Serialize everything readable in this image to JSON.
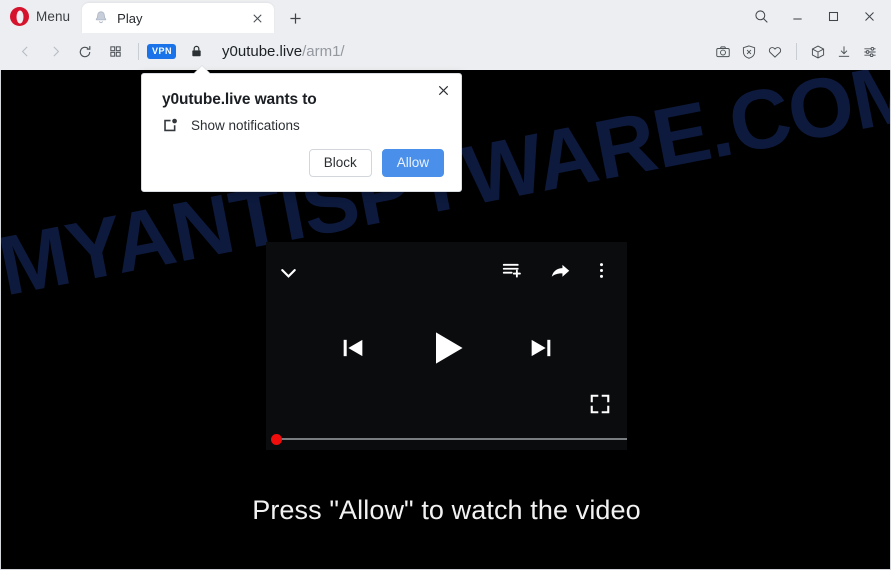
{
  "browser": {
    "name": "Opera",
    "menu_label": "Menu",
    "tab": {
      "title": "Play",
      "favicon": "bell-icon",
      "close_icon": "close-icon"
    },
    "new_tab_icon": "plus-icon",
    "window_controls": [
      {
        "name": "search",
        "icon": "search-icon",
        "glyph": "search"
      },
      {
        "name": "minimize",
        "icon": "minimize-icon",
        "glyph": "minimize"
      },
      {
        "name": "maximize",
        "icon": "maximize-icon",
        "glyph": "maximize"
      },
      {
        "name": "close",
        "icon": "close-icon",
        "glyph": "close"
      }
    ],
    "nav": {
      "back_icon": "back-arrow-icon",
      "forward_icon": "forward-arrow-icon",
      "reload_icon": "reload-icon",
      "speeddial_icon": "grid-tiles-icon",
      "vpn_label": "VPN",
      "lock_icon": "padlock-icon",
      "url_host": "y0utube.live",
      "url_path": "/arm1/",
      "url_full": "y0utube.live/arm1/"
    },
    "toolbar_right": [
      {
        "name": "snapshot",
        "icon": "camera-icon"
      },
      {
        "name": "ad-blocker",
        "icon": "shield-x-icon"
      },
      {
        "name": "favorites",
        "icon": "heart-icon"
      },
      {
        "name": "extensions",
        "icon": "cube-icon"
      },
      {
        "name": "downloads",
        "icon": "download-icon"
      },
      {
        "name": "easy-setup",
        "icon": "sliders-icon"
      }
    ]
  },
  "dialog": {
    "title": "y0utube.live wants to",
    "permission_icon": "notification-bubble-icon",
    "permission_label": "Show notifications",
    "close_icon": "close-icon",
    "block_label": "Block",
    "allow_label": "Allow",
    "allow_color": "#4a90ea"
  },
  "page": {
    "background_color": "#000000",
    "watermark_text": "MYANTISPYWARE.COM",
    "watermark_color": "#0d1a3d",
    "cta_text": "Press \"Allow\" to watch the video"
  },
  "player": {
    "background_color": "#0b0c0e",
    "collapse_icon": "chevron-down-icon",
    "queue_icon": "add-to-queue-icon",
    "share_icon": "share-arrow-icon",
    "more_icon": "more-vertical-icon",
    "previous_icon": "skip-previous-icon",
    "play_icon": "play-icon",
    "next_icon": "skip-next-icon",
    "fullscreen_icon": "fullscreen-icon",
    "progress_percent": 0,
    "progress_handle_color": "#f20d0d",
    "progress_track_color": "#7a7d80"
  }
}
